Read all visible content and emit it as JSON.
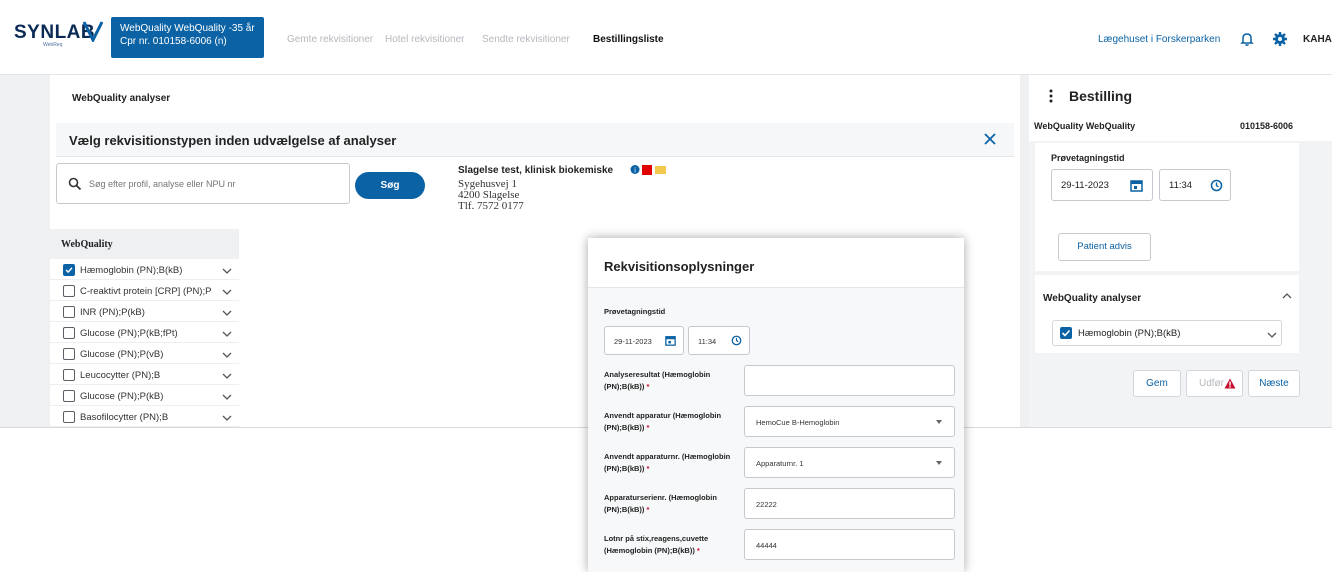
{
  "colors": {
    "primary": "#0b62a4",
    "warning": "#c8102e",
    "muted_tab": "#b4b8bd"
  },
  "header": {
    "logo": "SYNLAB",
    "logo_sub": "WebReq",
    "patient_line1": "WebQuality WebQuality -35 år",
    "patient_line2": "Cpr nr. 010158-6006 (n)",
    "tabs": [
      "Gemte rekvisitioner",
      "Hotel rekvisitioner",
      "Sendte rekvisitioner",
      "Bestillingsliste"
    ],
    "active_tab": "Bestillingsliste",
    "clinic": "Lægehuset i Forskerparken",
    "user": "KAHA",
    "icons": [
      "bell-icon",
      "gear-icon"
    ]
  },
  "main": {
    "title": "WebQuality analyser",
    "banner": "Vælg rekvisitionstypen inden udvælgelse af analyser",
    "search": {
      "placeholder": "Søg efter profil, analyse eller NPU nr",
      "value": "",
      "button": "Søg"
    },
    "lab": {
      "name": "Slagelse test, klinisk biokemiske",
      "address1": "Sygehusvej 1",
      "address2": "4200 Slagelse",
      "phone": "Tlf. 7572 0177"
    },
    "analyses_header": "WebQuality",
    "analyses": [
      {
        "label": "Hæmoglobin (PN);B(kB)",
        "checked": true
      },
      {
        "label": "C-reaktivt protein [CRP] (PN);P",
        "checked": false
      },
      {
        "label": "INR (PN);P(kB)",
        "checked": false
      },
      {
        "label": "Glucose (PN);P(kB;fPt)",
        "checked": false
      },
      {
        "label": "Glucose (PN);P(vB)",
        "checked": false
      },
      {
        "label": "Leucocytter (PN);B",
        "checked": false
      },
      {
        "label": "Glucose (PN);P(kB)",
        "checked": false
      },
      {
        "label": "Basofilocytter (PN);B",
        "checked": false
      }
    ]
  },
  "side": {
    "title": "Bestilling",
    "patient": "WebQuality WebQuality",
    "cpr": "010158-6006",
    "sample_time_label": "Prøvetagningstid",
    "date": "29-11-2023",
    "time": "11:34",
    "patient_advis": "Patient advis",
    "analyses_title": "WebQuality analyser",
    "selected_analysis": "Hæmoglobin (PN);B(kB)",
    "buttons": {
      "save": "Gem",
      "execute": "Udfør",
      "next": "Næste"
    }
  },
  "dialog": {
    "title": "Rekvisitionsoplysninger",
    "sample_time_label": "Prøvetagningstid",
    "date": "29-11-2023",
    "time": "11:34",
    "fields": [
      {
        "label_line1": "Analyseresultat (Hæmoglobin",
        "label_line2": "(PN);B(kB))",
        "value": "",
        "type": "text"
      },
      {
        "label_line1": "Anvendt apparatur (Hæmoglobin",
        "label_line2": "(PN);B(kB))",
        "value": "HemoCue B-Hemoglobin",
        "type": "select"
      },
      {
        "label_line1": "Anvendt apparaturnr. (Hæmoglobin",
        "label_line2": "(PN);B(kB))",
        "value": "Apparaturnr. 1",
        "type": "select"
      },
      {
        "label_line1": "Apparaturserienr. (Hæmoglobin",
        "label_line2": "(PN);B(kB))",
        "value": "22222",
        "type": "text"
      },
      {
        "label_line1": "Lotnr på stix,reagens,cuvette",
        "label_line2": "(Hæmoglobin (PN);B(kB))",
        "value": "44444",
        "type": "text"
      }
    ]
  }
}
